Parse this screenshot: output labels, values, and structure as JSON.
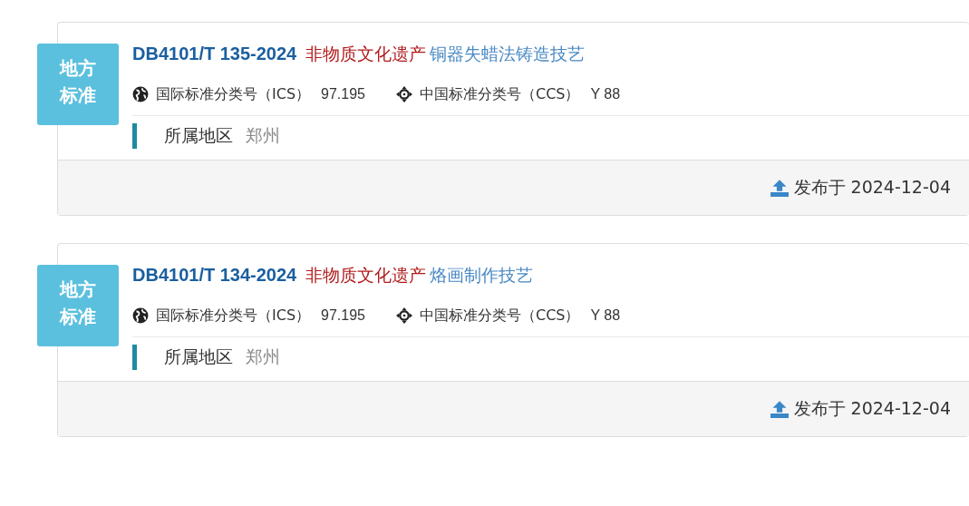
{
  "standards": [
    {
      "badge": "地方标准",
      "code": "DB4101/T 135-2024",
      "category": "非物质文化遗产",
      "title": "铜器失蜡法铸造技艺",
      "ics_label": "国际标准分类号（ICS）",
      "ics_value": "97.195",
      "ccs_label": "中国标准分类号（CCS）",
      "ccs_value": "Y 88",
      "region_label": "所属地区",
      "region_value": "郑州",
      "published": "发布于 2024-12-04"
    },
    {
      "badge": "地方标准",
      "code": "DB4101/T 134-2024",
      "category": "非物质文化遗产",
      "title": "烙画制作技艺",
      "ics_label": "国际标准分类号（ICS）",
      "ics_value": "97.195",
      "ccs_label": "中国标准分类号（CCS）",
      "ccs_value": "Y 88",
      "region_label": "所属地区",
      "region_value": "郑州",
      "published": "发布于 2024-12-04"
    }
  ]
}
